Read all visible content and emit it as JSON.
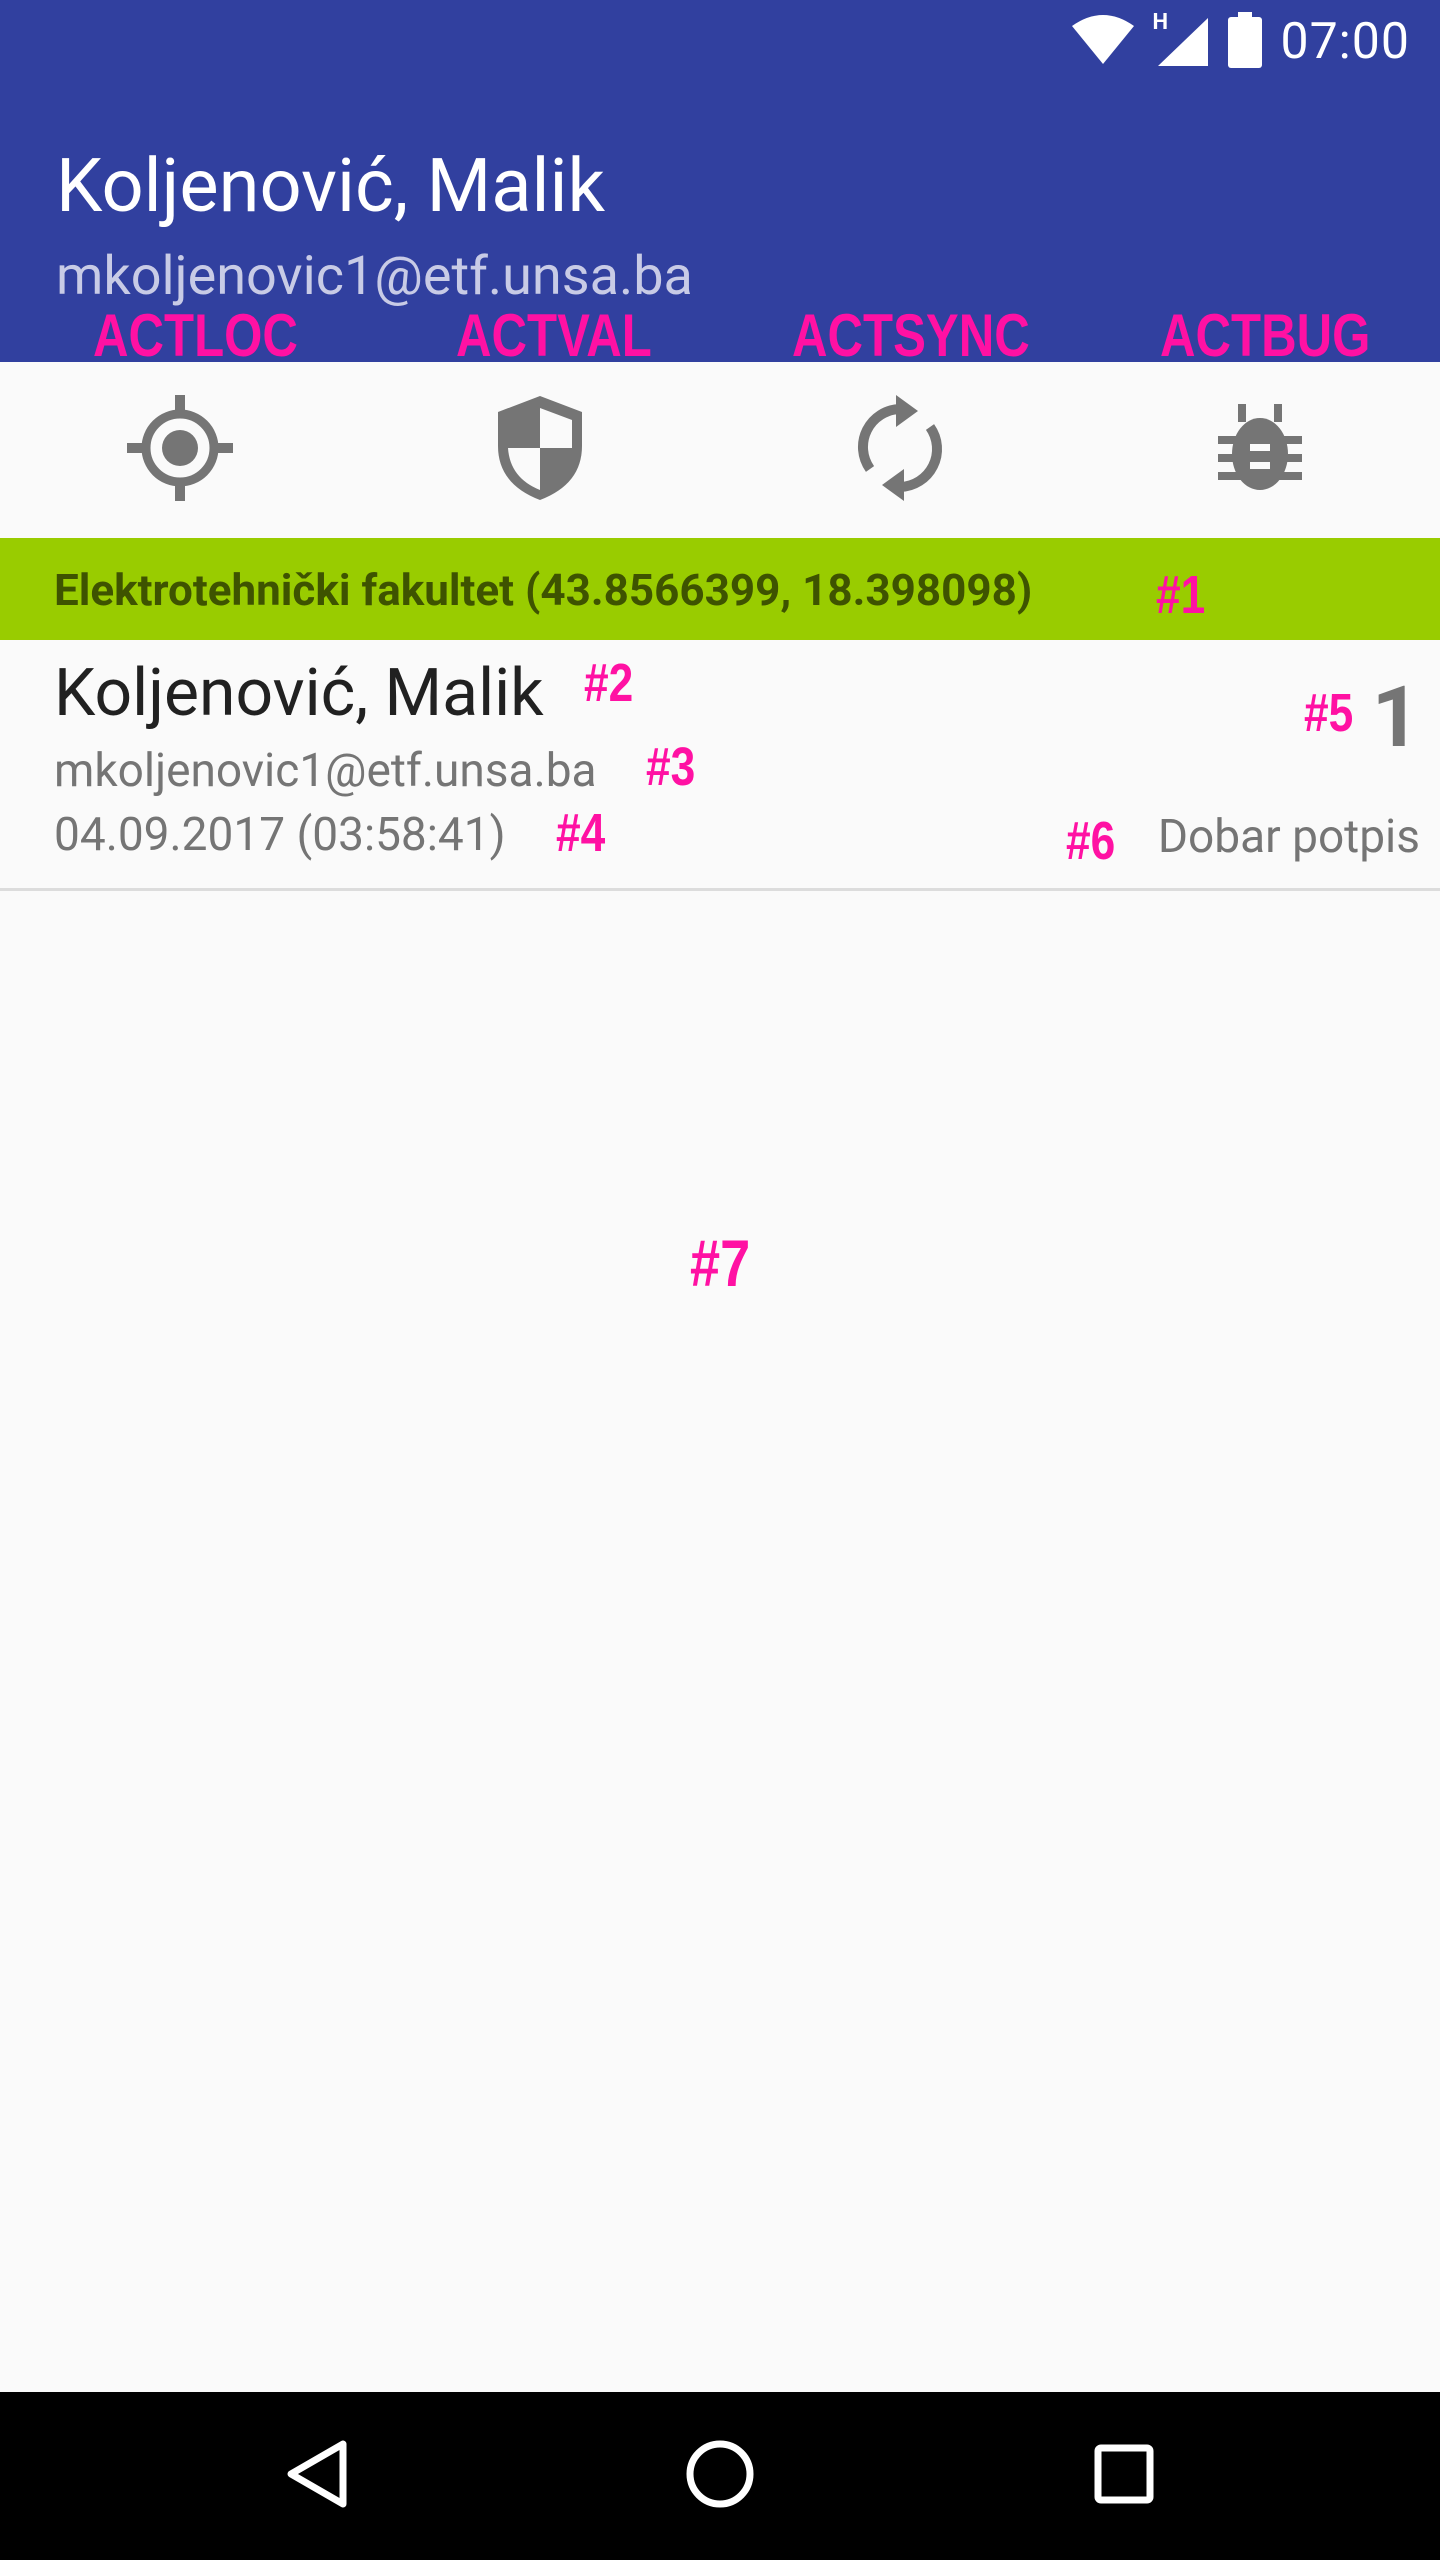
{
  "status_bar": {
    "network_label": "H",
    "time": "07:00"
  },
  "app_bar": {
    "title": "Koljenović, Malik",
    "subtitle": "mkoljenovic1@etf.unsa.ba"
  },
  "actions": [
    {
      "label": "ACTLOC",
      "icon": "location-target-icon"
    },
    {
      "label": "ACTVAL",
      "icon": "shield-icon"
    },
    {
      "label": "ACTSYNC",
      "icon": "sync-icon"
    },
    {
      "label": "ACTBUG",
      "icon": "bug-icon"
    }
  ],
  "location_banner": {
    "text": "Elektrotehnički fakultet (43.8566399, 18.398098)"
  },
  "signature_item": {
    "name": "Koljenović, Malik",
    "email": "mkoljenovic1@etf.unsa.ba",
    "date": "04.09.2017 (03:58:41)",
    "count": "1",
    "status": "Dobar potpis"
  },
  "markers": {
    "m1": "#1",
    "m2": "#2",
    "m3": "#3",
    "m4": "#4",
    "m5": "#5",
    "m6": "#6",
    "m7": "#7"
  },
  "colors": {
    "primary": "#31409f",
    "banner": "#99cc00",
    "banner_text": "#3e5300",
    "overlay": "#ff11a3",
    "icon_gray": "#757575"
  },
  "nav_bar": {
    "back_icon": "back-triangle-icon",
    "home_icon": "home-circle-icon",
    "recents_icon": "recents-square-icon"
  }
}
